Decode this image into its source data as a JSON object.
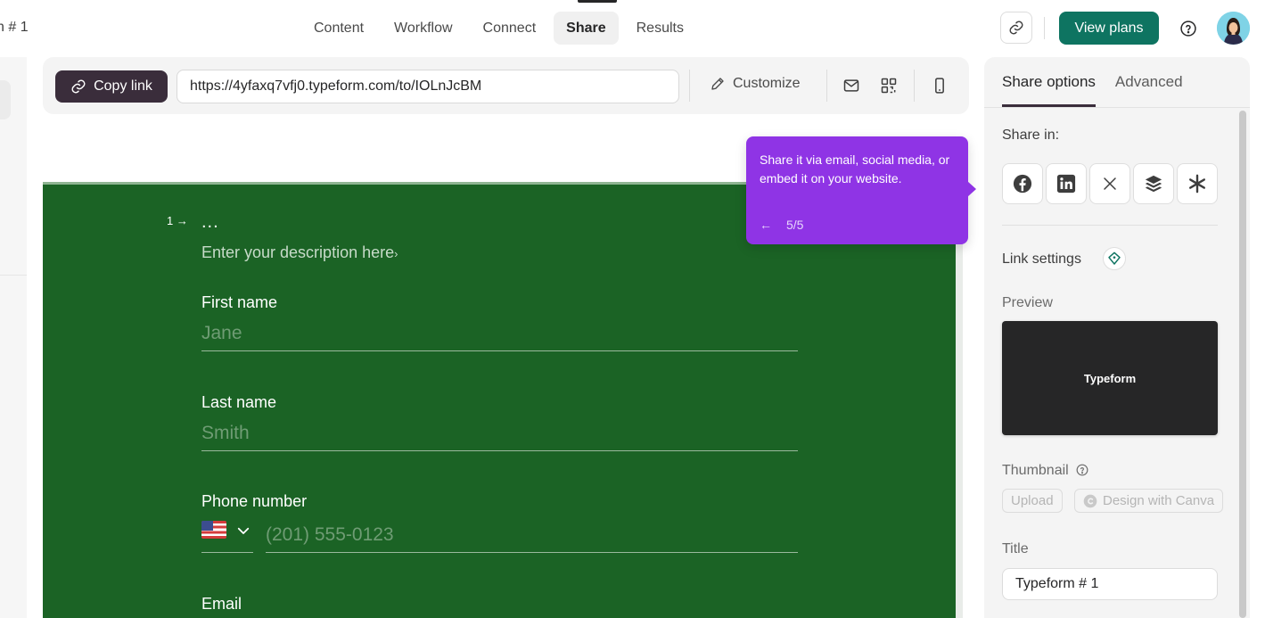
{
  "header": {
    "form_name": "n # 1",
    "tabs": [
      {
        "label": "Content"
      },
      {
        "label": "Workflow"
      },
      {
        "label": "Connect"
      },
      {
        "label": "Share"
      },
      {
        "label": "Results"
      }
    ],
    "active_tab": "Share",
    "view_plans_label": "View plans",
    "accent_color": "#0e7461"
  },
  "share_bar": {
    "copy_link_label": "Copy link",
    "url": "https://4yfaxq7vfj0.typeform.com/to/IOLnJcBM",
    "customize_label": "Customize",
    "icons": [
      "email-icon",
      "qr-code-icon",
      "mobile-preview-icon"
    ]
  },
  "form_preview": {
    "question_number": "1",
    "question_title": "...",
    "description_placeholder": "Enter your description here",
    "background_color": "#1b6325",
    "fields": [
      {
        "label": "First name",
        "placeholder": "Jane"
      },
      {
        "label": "Last name",
        "placeholder": "Smith"
      },
      {
        "label": "Phone number",
        "placeholder": "(201) 555-0123"
      },
      {
        "label": "Email"
      }
    ]
  },
  "tooltip": {
    "text": "Share it via email, social media, or embed it on your website.",
    "step": "5/5",
    "color": "#8f34e5"
  },
  "right_panel": {
    "tabs": [
      {
        "label": "Share options"
      },
      {
        "label": "Advanced"
      }
    ],
    "share_in_label": "Share in:",
    "social_icons": [
      "facebook-icon",
      "linkedin-icon",
      "x-icon",
      "buffer-icon",
      "asterisk-icon"
    ],
    "link_settings_label": "Link settings",
    "preview_label": "Preview",
    "preview_card_text": "Typeform",
    "thumbnail_label": "Thumbnail",
    "upload_label": "Upload",
    "canva_label": "Design with Canva",
    "title_label": "Title",
    "title_value": "Typeform # 1"
  }
}
